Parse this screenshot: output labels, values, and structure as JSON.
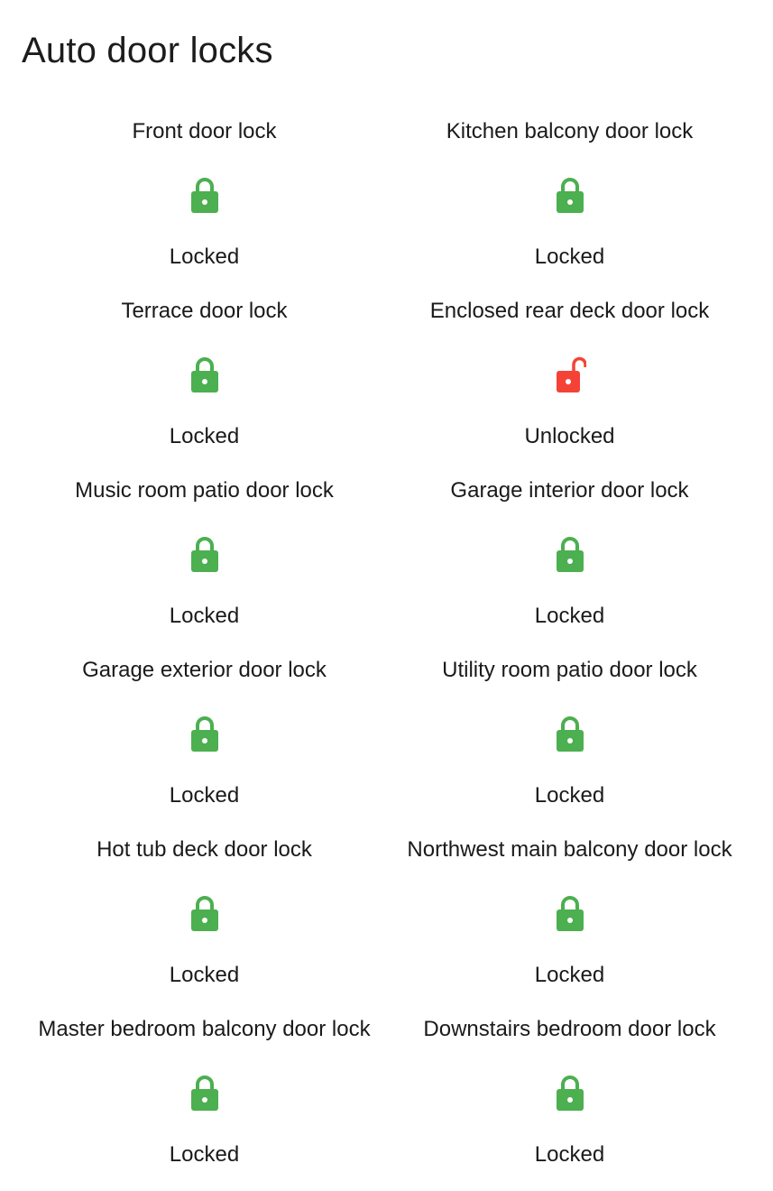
{
  "card": {
    "title": "Auto door locks"
  },
  "colors": {
    "locked": "#4caf50",
    "unlocked": "#f44336",
    "text": "#1a1a1a"
  },
  "locks": [
    {
      "name": "Front door lock",
      "state": "Locked",
      "icon": "lock-icon"
    },
    {
      "name": "Kitchen balcony door lock",
      "state": "Locked",
      "icon": "lock-icon"
    },
    {
      "name": "Terrace door lock",
      "state": "Locked",
      "icon": "lock-icon"
    },
    {
      "name": "Enclosed rear deck door lock",
      "state": "Unlocked",
      "icon": "lock-open-icon"
    },
    {
      "name": "Music room patio door lock",
      "state": "Locked",
      "icon": "lock-icon"
    },
    {
      "name": "Garage interior door lock",
      "state": "Locked",
      "icon": "lock-icon"
    },
    {
      "name": "Garage exterior door lock",
      "state": "Locked",
      "icon": "lock-icon"
    },
    {
      "name": "Utility room patio door lock",
      "state": "Locked",
      "icon": "lock-icon"
    },
    {
      "name": "Hot tub deck door lock",
      "state": "Locked",
      "icon": "lock-icon"
    },
    {
      "name": "Northwest main balcony door lock",
      "state": "Locked",
      "icon": "lock-icon"
    },
    {
      "name": "Master bedroom balcony door lock",
      "state": "Locked",
      "icon": "lock-icon"
    },
    {
      "name": "Downstairs bedroom door lock",
      "state": "Locked",
      "icon": "lock-icon"
    }
  ]
}
